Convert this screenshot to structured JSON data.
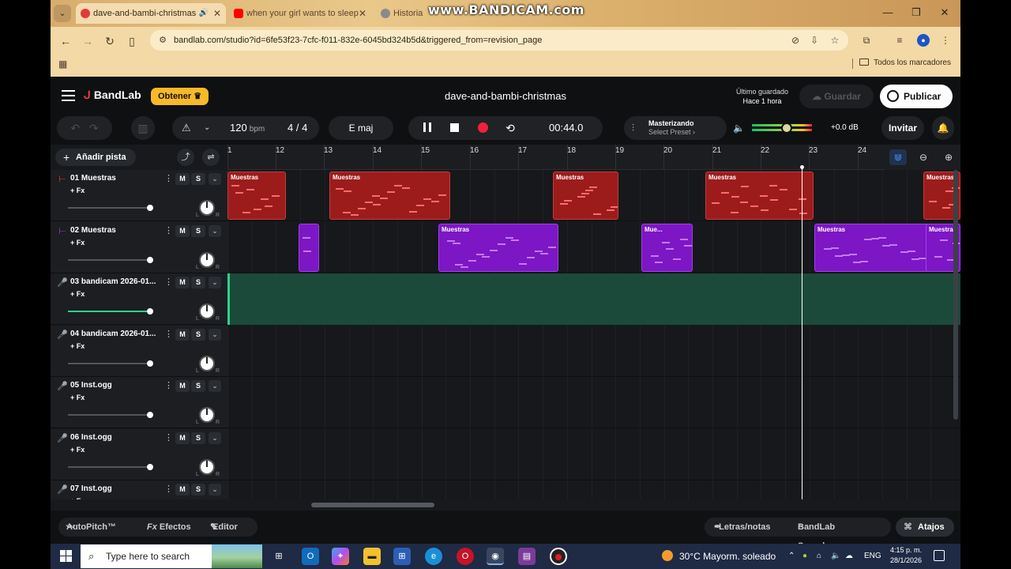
{
  "watermark": "www.BANDICAM.com",
  "browser": {
    "tabs": [
      {
        "title": "dave-and-bambi-christmas",
        "active": true
      },
      {
        "title": "when your girl wants to sleep"
      },
      {
        "title": "Historia"
      }
    ],
    "url": "bandlab.com/studio?id=6fe53f23-7cfc-f011-832e-6045bd324b5d&triggered_from=revision_page",
    "bookmarks_all": "Todos los marcadores"
  },
  "header": {
    "logo": "BandLab",
    "obtener": "Obtener",
    "project_title": "dave-and-bambi-christmas",
    "saved_label": "Último guardado",
    "saved_time": "Hace 1 hora",
    "guardar": "Guardar",
    "publicar": "Publicar"
  },
  "transport": {
    "tempo": "120",
    "bpm_unit": "bpm",
    "time_sig": "4 / 4",
    "key": "E maj",
    "time": "00:44.0",
    "mastering_title": "Masterizando",
    "mastering_preset": "Select Preset ›",
    "volume_level": 0.6,
    "db": "+0.0 dB",
    "invitar": "Invitar"
  },
  "toolbar": {
    "add_track": "Añadir pista"
  },
  "ruler": [
    "1",
    "12",
    "13",
    "14",
    "15",
    "16",
    "17",
    "18",
    "19",
    "20",
    "21",
    "22",
    "23",
    "24"
  ],
  "tracks": [
    {
      "number": "01",
      "name": "Muestras",
      "color": "#e23a3a",
      "icon": "sampler-icon"
    },
    {
      "number": "02",
      "name": "Muestras",
      "color": "#9b3ae2",
      "icon": "sampler-icon"
    },
    {
      "number": "03",
      "name": "bandicam 2026-01...",
      "color": "#2fd18a",
      "icon": "microphone-icon"
    },
    {
      "number": "04",
      "name": "bandicam 2026-01...",
      "color": "#f2a31f",
      "icon": "microphone-icon"
    },
    {
      "number": "05",
      "name": "Inst.ogg",
      "color": "#f25a1f",
      "icon": "microphone-icon"
    },
    {
      "number": "06",
      "name": "Inst.ogg",
      "color": "#2fd18a",
      "icon": "microphone-icon"
    },
    {
      "number": "07",
      "name": "Inst.ogg",
      "color": "#f2a31f",
      "icon": "microphone-icon"
    }
  ],
  "track_common": {
    "mute": "M",
    "solo": "S",
    "fx": "+ Fx",
    "pan_l": "L",
    "pan_r": "R"
  },
  "clips": {
    "sample": "Muestras",
    "short": "Mue..."
  },
  "bottom": {
    "autopitch": "AutoPitch™",
    "efectos": "Efectos",
    "editor": "Editor",
    "letras": "Letras/notas",
    "sounds": "BandLab Sounds",
    "atajos": "Atajos"
  },
  "taskbar": {
    "search_placeholder": "Type here to search",
    "weather": "30°C  Mayorm. soleado",
    "lang": "ENG",
    "time": "4:15 p. m.",
    "date": "28/1/2026"
  }
}
